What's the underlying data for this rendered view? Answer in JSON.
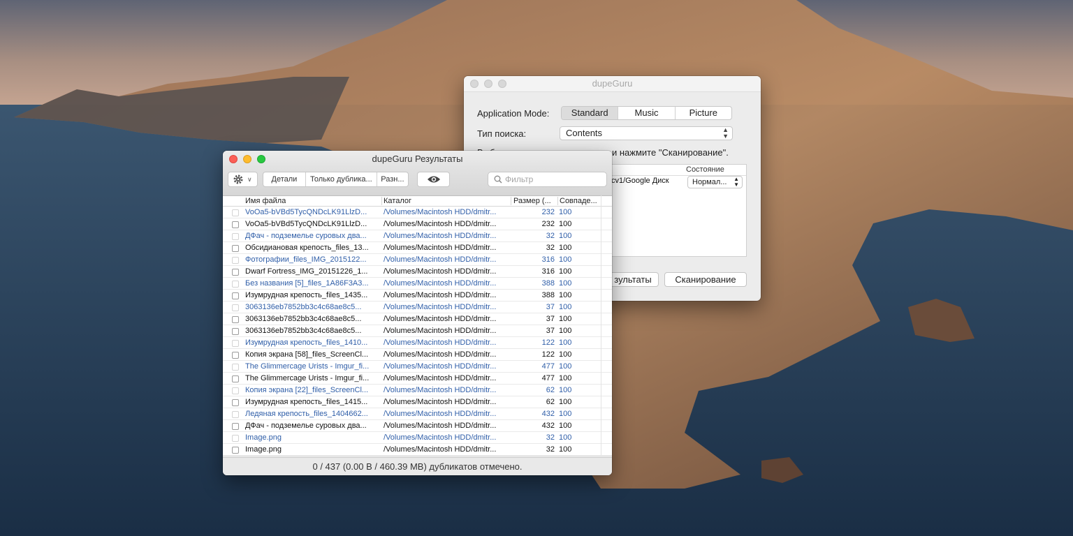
{
  "colors": {
    "reference_blue": "#2f5ea8",
    "close_red": "#fc5f57",
    "minimize_yellow": "#febc2e",
    "zoom_green": "#28c840"
  },
  "main_window": {
    "title": "dupeGuru",
    "app_mode_label": "Application Mode:",
    "modes": [
      "Standard",
      "Music",
      "Picture"
    ],
    "selected_mode": "Standard",
    "scan_type_label": "Тип поиска:",
    "scan_type_value": "Contents",
    "instruction_tail": "и нажмите \"Сканирование\".",
    "instruction_fragment": "Выб",
    "state_header": "Состояние",
    "dir_path": "cv1/Google Диск",
    "dir_state": "Нормал...",
    "results_button": "зультаты",
    "scan_button": "Сканирование"
  },
  "results_window": {
    "title": "dupeGuru Результаты",
    "toolbar": {
      "settings_icon": "gear-icon",
      "details": "Детали",
      "dupes_only": "Только дублика...",
      "delta": "Разн...",
      "quicklook_icon": "eye-icon",
      "filter_placeholder": "Фильтр"
    },
    "columns": {
      "name": "Имя файла",
      "folder": "Каталог",
      "size": "Размер (...",
      "match": "Совпаде..."
    },
    "rows": [
      {
        "name": "VoOa5-bVBd5TycQNDcLK91LlzD...",
        "folder": "/Volumes/Macintosh HDD/dmitr...",
        "size": "232",
        "match": "100",
        "ref": true
      },
      {
        "name": "VoOa5-bVBd5TycQNDcLK91LlzD...",
        "folder": "/Volumes/Macintosh HDD/dmitr...",
        "size": "232",
        "match": "100",
        "ref": false
      },
      {
        "name": "ДФач - подземелье суровых два...",
        "folder": "/Volumes/Macintosh HDD/dmitr...",
        "size": "32",
        "match": "100",
        "ref": true
      },
      {
        "name": "Обсидиановая крепость_files_13...",
        "folder": "/Volumes/Macintosh HDD/dmitr...",
        "size": "32",
        "match": "100",
        "ref": false
      },
      {
        "name": "Фотографии_files_IMG_2015122...",
        "folder": "/Volumes/Macintosh HDD/dmitr...",
        "size": "316",
        "match": "100",
        "ref": true
      },
      {
        "name": "Dwarf Fortress_IMG_20151226_1...",
        "folder": "/Volumes/Macintosh HDD/dmitr...",
        "size": "316",
        "match": "100",
        "ref": false
      },
      {
        "name": "Без названия [5]_files_1A86F3A3...",
        "folder": "/Volumes/Macintosh HDD/dmitr...",
        "size": "388",
        "match": "100",
        "ref": true
      },
      {
        "name": "Изумрудная крепость_files_1435...",
        "folder": "/Volumes/Macintosh HDD/dmitr...",
        "size": "388",
        "match": "100",
        "ref": false
      },
      {
        "name": "3063136eb7852bb3c4c68ae8c5...",
        "folder": "/Volumes/Macintosh HDD/dmitr...",
        "size": "37",
        "match": "100",
        "ref": true
      },
      {
        "name": "3063136eb7852bb3c4c68ae8c5...",
        "folder": "/Volumes/Macintosh HDD/dmitr...",
        "size": "37",
        "match": "100",
        "ref": false
      },
      {
        "name": "3063136eb7852bb3c4c68ae8c5...",
        "folder": "/Volumes/Macintosh HDD/dmitr...",
        "size": "37",
        "match": "100",
        "ref": false
      },
      {
        "name": "Изумрудная крепость_files_1410...",
        "folder": "/Volumes/Macintosh HDD/dmitr...",
        "size": "122",
        "match": "100",
        "ref": true
      },
      {
        "name": "Копия экрана [58]_files_ScreenCl...",
        "folder": "/Volumes/Macintosh HDD/dmitr...",
        "size": "122",
        "match": "100",
        "ref": false
      },
      {
        "name": "The Glimmercage Urists - Imgur_fi...",
        "folder": "/Volumes/Macintosh HDD/dmitr...",
        "size": "477",
        "match": "100",
        "ref": true
      },
      {
        "name": "The Glimmercage Urists - Imgur_fi...",
        "folder": "/Volumes/Macintosh HDD/dmitr...",
        "size": "477",
        "match": "100",
        "ref": false
      },
      {
        "name": "Копия экрана [22]_files_ScreenCl...",
        "folder": "/Volumes/Macintosh HDD/dmitr...",
        "size": "62",
        "match": "100",
        "ref": true
      },
      {
        "name": "Изумрудная крепость_files_1415...",
        "folder": "/Volumes/Macintosh HDD/dmitr...",
        "size": "62",
        "match": "100",
        "ref": false
      },
      {
        "name": "Ледяная крепость_files_1404662...",
        "folder": "/Volumes/Macintosh HDD/dmitr...",
        "size": "432",
        "match": "100",
        "ref": true
      },
      {
        "name": "ДФач - подземелье суровых два...",
        "folder": "/Volumes/Macintosh HDD/dmitr...",
        "size": "432",
        "match": "100",
        "ref": false
      },
      {
        "name": "Image.png",
        "folder": "/Volumes/Macintosh HDD/dmitr...",
        "size": "32",
        "match": "100",
        "ref": true
      },
      {
        "name": "Image.png",
        "folder": "/Volumes/Macintosh HDD/dmitr...",
        "size": "32",
        "match": "100",
        "ref": false
      }
    ],
    "status": "0 / 437 (0.00 B / 460.39 MB) дубликатов отмечено."
  }
}
